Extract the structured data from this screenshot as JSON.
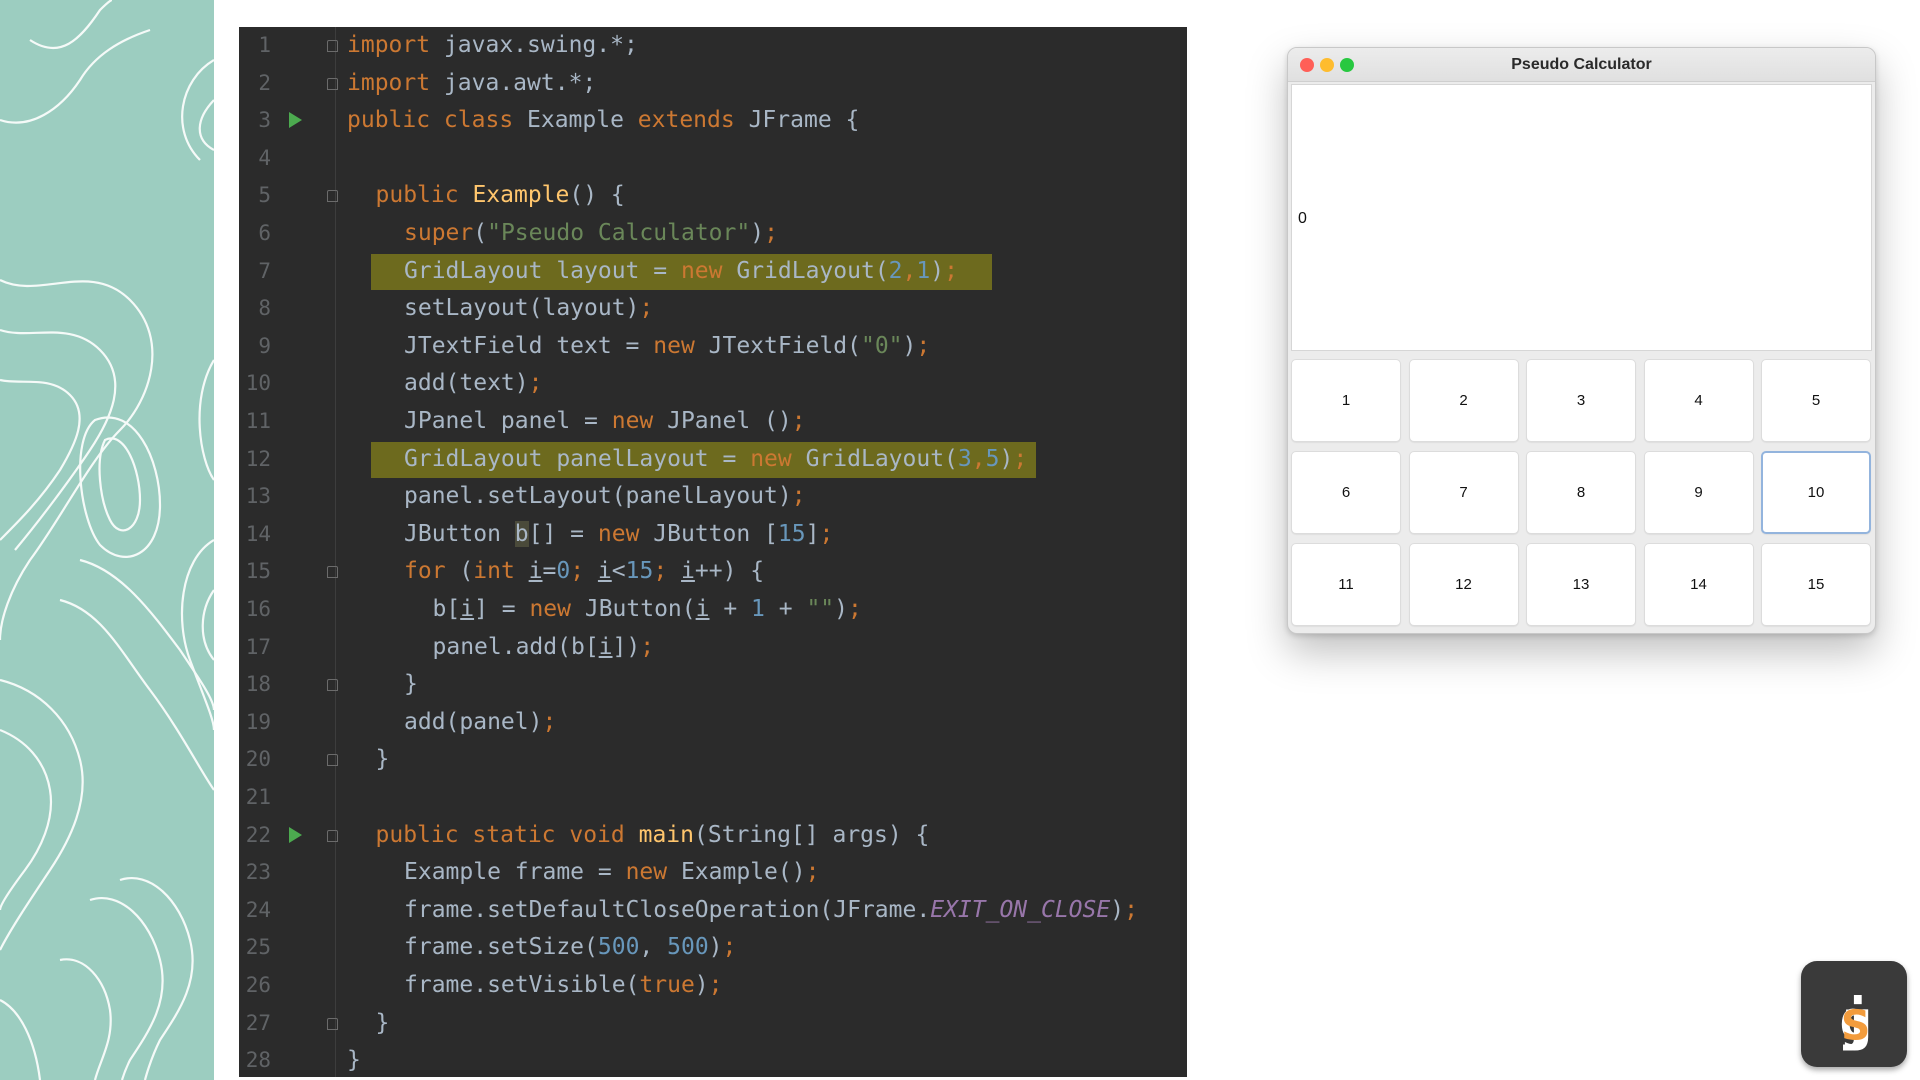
{
  "editor": {
    "line_numbers": [
      "1",
      "2",
      "3",
      "4",
      "5",
      "6",
      "7",
      "8",
      "9",
      "10",
      "11",
      "12",
      "13",
      "14",
      "15",
      "16",
      "17",
      "18",
      "19",
      "20",
      "21",
      "22",
      "23",
      "24",
      "25",
      "26",
      "27",
      "28"
    ],
    "lines": [
      [
        "import",
        " javax.swing.*",
        ";"
      ],
      [
        "import",
        " java.awt.*",
        ";"
      ],
      [
        "public class ",
        "Example ",
        "extends ",
        "JFrame {"
      ],
      [],
      [
        "public ",
        "Example",
        "() {"
      ],
      [
        "super",
        "(",
        "\"Pseudo Calculator\"",
        ")",
        ";"
      ],
      [
        "GridLayout layout = ",
        "new ",
        "GridLayout(",
        "2",
        ",",
        "1",
        ")",
        ";"
      ],
      [
        "setLayout(layout)",
        ";"
      ],
      [
        "JTextField text = ",
        "new ",
        "JTextField(",
        "\"0\"",
        ")",
        ";"
      ],
      [
        "add(text)",
        ";"
      ],
      [
        "JPanel panel = ",
        "new ",
        "JPanel ()",
        ";"
      ],
      [
        "GridLayout panelLayout = ",
        "new ",
        "GridLayout(",
        "3",
        ",",
        "5",
        ")",
        ";"
      ],
      [
        "panel.setLayout(panelLayout)",
        ";"
      ],
      [
        "JButton ",
        "b",
        "[] = ",
        "new ",
        "JButton [",
        "15",
        "]",
        ";"
      ],
      [
        "for ",
        "(",
        "int ",
        "i",
        "=",
        "0",
        "; ",
        "i",
        "<",
        "15",
        "; ",
        "i",
        "++) {"
      ],
      [
        "b[",
        "i",
        "] = ",
        "new ",
        "JButton(",
        "i",
        " + ",
        "1",
        " + ",
        "\"\"",
        ")",
        ";"
      ],
      [
        "panel.add(b[",
        "i",
        "])",
        ";"
      ],
      [
        "}"
      ],
      [
        "add(panel)",
        ";"
      ],
      [
        "}"
      ],
      [],
      [
        "public static void ",
        "main",
        "(String[] args) {"
      ],
      [
        "Example frame = ",
        "new ",
        "Example()",
        ";"
      ],
      [
        "frame.setDefaultCloseOperation(JFrame.",
        "EXIT_ON_CLOSE",
        ")",
        ";"
      ],
      [
        "frame.setSize(",
        "500",
        ", ",
        "500",
        ")",
        ";"
      ],
      [
        "frame.setVisible(",
        "true",
        ")",
        ";"
      ],
      [
        "}"
      ],
      [
        "}"
      ]
    ]
  },
  "window": {
    "title": "Pseudo Calculator",
    "text_field_value": "0",
    "buttons": [
      "1",
      "2",
      "3",
      "4",
      "5",
      "6",
      "7",
      "8",
      "9",
      "10",
      "11",
      "12",
      "13",
      "14",
      "15"
    ],
    "focused_button": "10",
    "traffic_lights": {
      "close": "#ff5f57",
      "minimize": "#febc2e",
      "zoom": "#28c840"
    }
  },
  "logo": {
    "text_j": "j",
    "text_g": "g",
    "text_s": "s"
  },
  "colors": {
    "background_pattern": "#9ccdc0",
    "editor_bg": "#2b2b2b",
    "highlight": "#6d6a1e",
    "logo_accent": "#f39c3d"
  }
}
